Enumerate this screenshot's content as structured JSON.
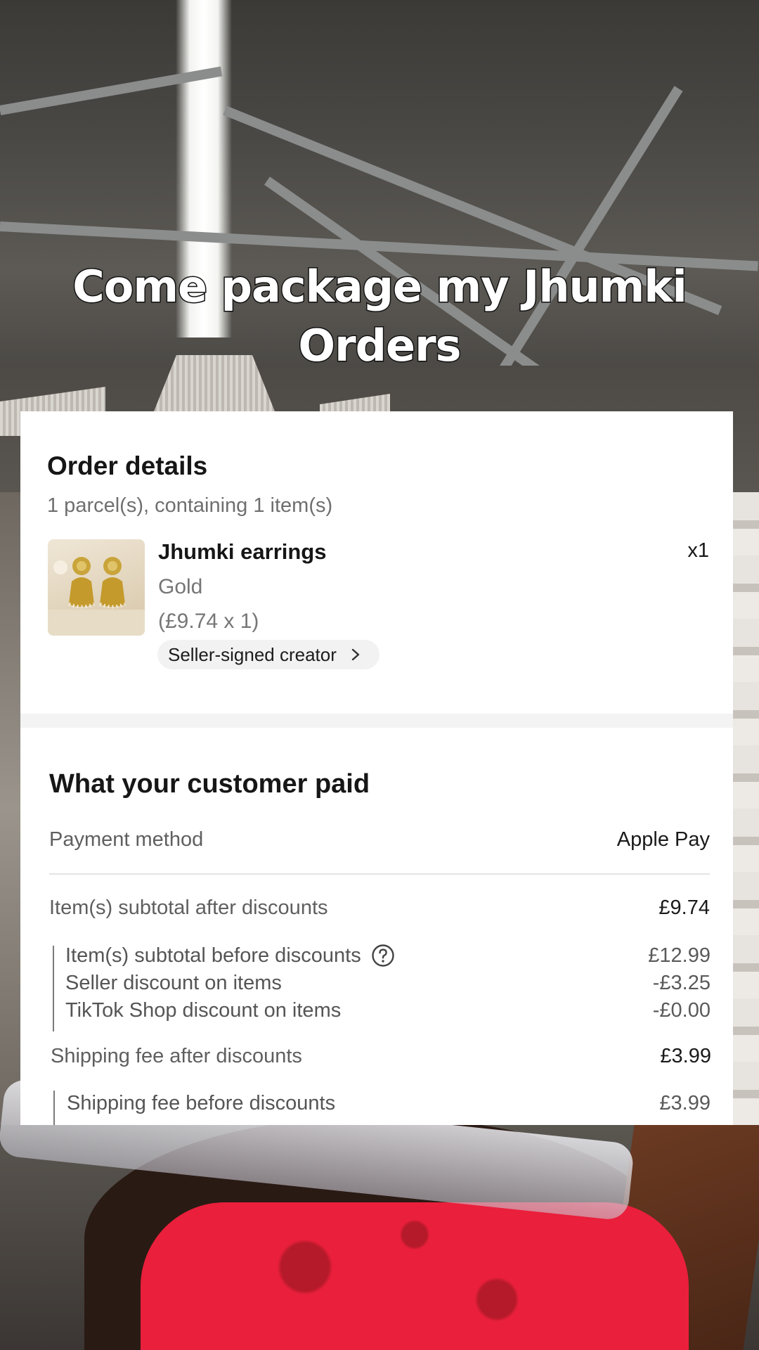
{
  "caption": {
    "line1": "Come package my Jhumki",
    "line2": "Orders"
  },
  "order_details": {
    "title": "Order details",
    "summary": "1 parcel(s), containing 1 item(s)",
    "item": {
      "image_icon": "jhumki-earrings-photo",
      "name": "Jhumki earrings",
      "variant": "Gold",
      "unit_price": "(£9.74 x 1)",
      "quantity": "x1",
      "chip_label": "Seller-signed creator",
      "chip_icon": "chevron-right-icon"
    }
  },
  "customer_paid": {
    "title": "What your customer paid",
    "payment_method": {
      "label": "Payment method",
      "value": "Apple Pay"
    },
    "items_subtotal_after": {
      "label": "Item(s) subtotal after discounts",
      "value": "£9.74"
    },
    "items_breakdown": [
      {
        "label": "Item(s) subtotal before discounts",
        "value": "£12.99",
        "icon": "help-circle-icon"
      },
      {
        "label": "Seller discount on items",
        "value": "-£3.25"
      },
      {
        "label": "TikTok Shop discount on items",
        "value": "-£0.00"
      }
    ],
    "shipping_after": {
      "label": "Shipping fee after discounts",
      "value": "£3.99"
    },
    "shipping_breakdown": [
      {
        "label": "Shipping fee before discounts",
        "value": "£3.99"
      }
    ]
  },
  "colors": {
    "card_background": "#ffffff",
    "primary_text": "#161616",
    "secondary_text": "#6f6f6f",
    "chip_background": "#f2f2f2",
    "shirt_red": "#ea1f3b"
  }
}
